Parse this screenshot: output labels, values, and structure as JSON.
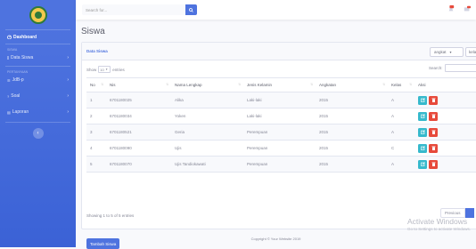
{
  "sidebar": {
    "dashboard_label": "Dashboard",
    "heading_siswa": "SISWA",
    "data_siswa_label": "Data Siswa",
    "heading_pertanyaan": "PERTANYAAN",
    "item_jdbp": "JdB-p",
    "item_soal": "Soal",
    "item_laporan": "Laporan",
    "toggle_icon": "chevron-left-icon"
  },
  "topbar": {
    "search_placeholder": "Search for...",
    "search_icon": "search-icon"
  },
  "page": {
    "title": "Siswa"
  },
  "card": {
    "header_title": "Data Siswa",
    "filter_angkatan": "angkat",
    "filter_kelas": "kelas",
    "show_label": "Show",
    "show_value": "10",
    "entries_label": "entries",
    "search_label": "Search:",
    "columns": [
      "No",
      "Nis",
      "Nama Lengkap",
      "Jenis Kelamin",
      "Angkatan",
      "Kelas",
      "Aksi"
    ],
    "rows": [
      [
        "1",
        "6701180025",
        "Alika",
        "Laki-laki",
        "2015",
        "A"
      ],
      [
        "2",
        "6701180034",
        "Yoken",
        "Laki-laki",
        "2015",
        "A"
      ],
      [
        "3",
        "6701180521",
        "Geria",
        "Perempuan",
        "2015",
        "A"
      ],
      [
        "4",
        "6701180090",
        "Ujis",
        "Perempuan",
        "2015",
        "C"
      ],
      [
        "5",
        "6701180070",
        "Ujis Tandiokawati",
        "Perempuan",
        "2015",
        "A"
      ]
    ],
    "info": "Showing 1 to 5 of 5 entries",
    "prev_label": "Previous",
    "add_button": "Tambah Siswa"
  },
  "watermark": {
    "title": "Activate Windows",
    "subtitle": "Go to Settings to activate Windows."
  },
  "footer": {
    "text": "Copyright © Your Website 2019"
  },
  "colors": {
    "primary": "#4e73df",
    "info": "#36b9cc",
    "danger": "#e74a3b"
  }
}
